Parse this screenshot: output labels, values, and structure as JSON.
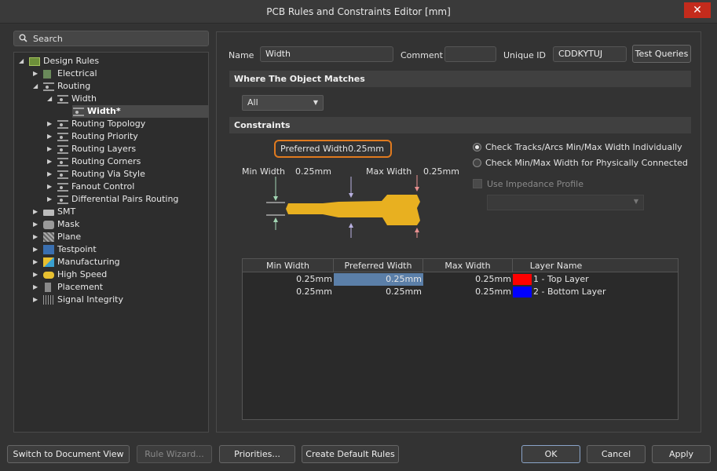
{
  "window": {
    "title": "PCB Rules and Constraints Editor [mm]",
    "close_glyph": "✕"
  },
  "search": {
    "placeholder": "Search",
    "icon": "search-icon"
  },
  "tree": {
    "root": "Design Rules",
    "items": [
      {
        "label": "Electrical"
      },
      {
        "label": "Routing"
      },
      {
        "label": "Width"
      },
      {
        "label": "Width*"
      },
      {
        "label": "Routing Topology"
      },
      {
        "label": "Routing Priority"
      },
      {
        "label": "Routing Layers"
      },
      {
        "label": "Routing Corners"
      },
      {
        "label": "Routing Via Style"
      },
      {
        "label": "Fanout Control"
      },
      {
        "label": "Differential Pairs Routing"
      },
      {
        "label": "SMT"
      },
      {
        "label": "Mask"
      },
      {
        "label": "Plane"
      },
      {
        "label": "Testpoint"
      },
      {
        "label": "Manufacturing"
      },
      {
        "label": "High Speed"
      },
      {
        "label": "Placement"
      },
      {
        "label": "Signal Integrity"
      }
    ]
  },
  "rule": {
    "name_label": "Name",
    "name_value": "Width",
    "comment_label": "Comment",
    "comment_value": "",
    "uid_label": "Unique ID",
    "uid_value": "CDDKYTUJ",
    "test_queries": "Test Queries"
  },
  "match": {
    "header": "Where The Object Matches",
    "dropdown_value": "All"
  },
  "constraints": {
    "header": "Constraints",
    "preferred_label": "Preferred Width",
    "preferred_value": "0.25mm",
    "min_label": "Min Width",
    "min_value": "0.25mm",
    "max_label": "Max Width",
    "max_value": "0.25mm",
    "radio1": "Check Tracks/Arcs Min/Max Width Individually",
    "radio2": "Check Min/Max Width for Physically Connected",
    "impedance": "Use Impedance Profile",
    "trace_color": "#e8b020"
  },
  "table": {
    "headers": [
      "Min Width",
      "Preferred Width",
      "Max Width",
      "Layer Name"
    ],
    "rows": [
      {
        "min": "0.25mm",
        "pref": "0.25mm",
        "max": "0.25mm",
        "layer": "1 - Top Layer",
        "color": "#ff0000"
      },
      {
        "min": "0.25mm",
        "pref": "0.25mm",
        "max": "0.25mm",
        "layer": "2 - Bottom Layer",
        "color": "#0000ff"
      }
    ]
  },
  "footer": {
    "switch": "Switch to Document View",
    "wizard": "Rule Wizard...",
    "priorities": "Priorities...",
    "create": "Create Default Rules",
    "ok": "OK",
    "cancel": "Cancel",
    "apply": "Apply"
  }
}
